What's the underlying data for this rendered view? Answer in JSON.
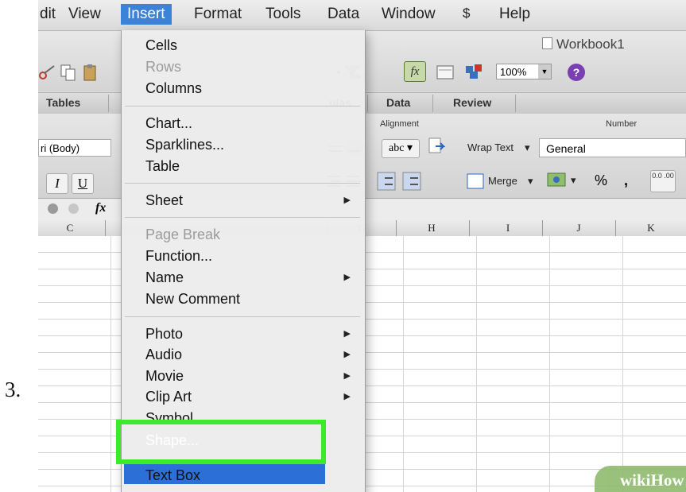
{
  "step_label": "3.",
  "menubar": {
    "items": [
      "dit",
      "View",
      "Insert",
      "Format",
      "Tools",
      "Data",
      "Window",
      "Help"
    ],
    "active": "Insert"
  },
  "toolbar": {
    "workbook_title": "Workbook1",
    "zoom": "100%",
    "help_label": "?"
  },
  "ribbon": {
    "tabs": [
      "Tables",
      "ulas",
      "Data",
      "Review"
    ],
    "groups": {
      "alignment": "Alignment",
      "number": "Number"
    },
    "font_name": "ri (Body)",
    "bold_italic": {
      "italic": "I",
      "underline": "U"
    },
    "wrap_text_label": "Wrap Text",
    "merge_label": "Merge",
    "abc_label": "abc",
    "number_format": "General",
    "percent_label": "%",
    "comma_label": ",",
    "decimal_label": "0.0 .00"
  },
  "formula_bar": {
    "fx_label": "fx"
  },
  "columns": [
    "C",
    "G",
    "H",
    "I",
    "J",
    "K"
  ],
  "insert_menu": {
    "items": [
      {
        "label": "Cells",
        "disabled": false,
        "submenu": false
      },
      {
        "label": "Rows",
        "disabled": true,
        "submenu": false
      },
      {
        "label": "Columns",
        "disabled": false,
        "submenu": false
      },
      {
        "label": "Chart...",
        "disabled": false,
        "submenu": false
      },
      {
        "label": "Sparklines...",
        "disabled": false,
        "submenu": false
      },
      {
        "label": "Table",
        "disabled": false,
        "submenu": false
      },
      {
        "label": "Sheet",
        "disabled": false,
        "submenu": true
      },
      {
        "label": "Page Break",
        "disabled": true,
        "submenu": false
      },
      {
        "label": "Function...",
        "disabled": false,
        "submenu": false
      },
      {
        "label": "Name",
        "disabled": false,
        "submenu": true
      },
      {
        "label": "New Comment",
        "disabled": false,
        "submenu": false
      },
      {
        "label": "Photo",
        "disabled": false,
        "submenu": true
      },
      {
        "label": "Audio",
        "disabled": false,
        "submenu": true
      },
      {
        "label": "Movie",
        "disabled": false,
        "submenu": true
      },
      {
        "label": "Clip Art",
        "disabled": false,
        "submenu": true
      },
      {
        "label": "Symbol...",
        "disabled": false,
        "submenu": false
      },
      {
        "label": "Shape...",
        "disabled": false,
        "submenu": false,
        "selected": true
      },
      {
        "label": "Text Box",
        "disabled": false,
        "submenu": false
      }
    ]
  },
  "watermark": "wikiHow",
  "colors": {
    "selection": "#2c6fd6",
    "callout": "#3cea2a"
  }
}
